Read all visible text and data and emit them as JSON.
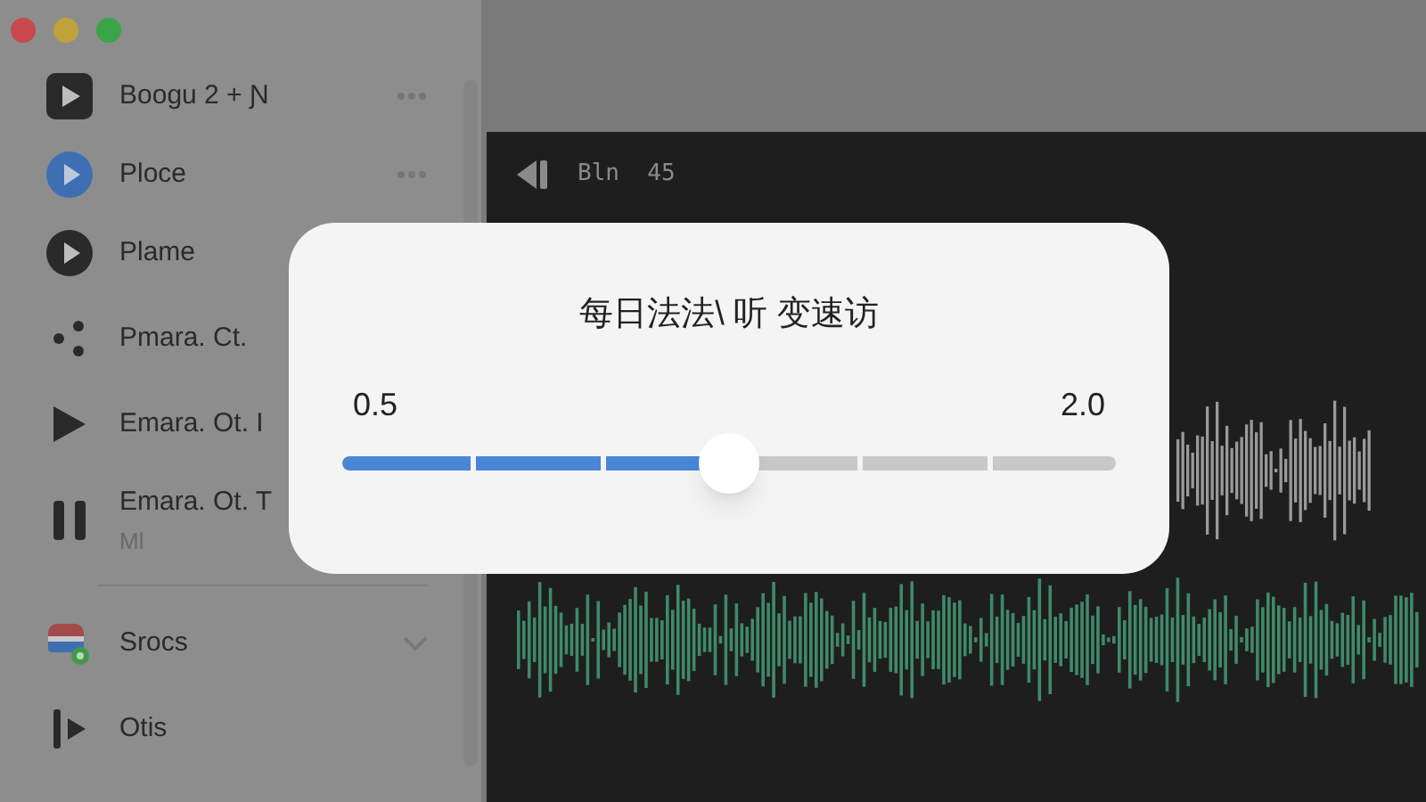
{
  "sidebar": {
    "items": [
      {
        "label": "Boogu 2 + Ɲ",
        "kind": "square-play",
        "has_menu": true
      },
      {
        "label": "Ploce",
        "kind": "blue-play",
        "has_menu": true
      },
      {
        "label": "Plame",
        "kind": "dark-play",
        "has_menu": false
      },
      {
        "label": "Pmara. Ct.",
        "kind": "dots",
        "has_menu": false
      },
      {
        "label": "Emara. Ot. I",
        "kind": "play",
        "has_menu": false
      },
      {
        "label": "Emara. Ot. T",
        "sublabel": "Ml",
        "kind": "pause",
        "has_menu": false
      }
    ],
    "groups": [
      {
        "label": "Srocs",
        "kind": "badge",
        "expanded": true
      },
      {
        "label": "Otis",
        "kind": "skip"
      }
    ]
  },
  "track": {
    "title": "Bln  45"
  },
  "dialog": {
    "title": "每日法法\\ 听 变速访",
    "min": "0.5",
    "max": "2.0",
    "level": 0.5
  }
}
